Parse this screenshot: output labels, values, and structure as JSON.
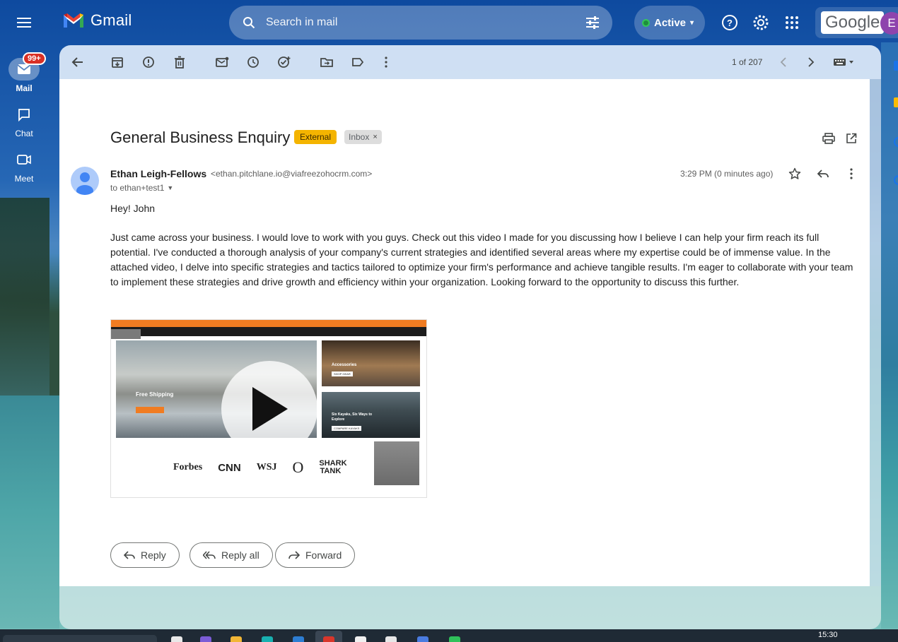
{
  "app": {
    "name": "Gmail",
    "status": "Active",
    "google_word": "Google",
    "account_initial": "E"
  },
  "search": {
    "placeholder": "Search in mail"
  },
  "rail": {
    "items": [
      {
        "label": "Mail",
        "badge": "99+",
        "icon": "mail-icon",
        "active": true
      },
      {
        "label": "Chat",
        "icon": "chat-icon",
        "active": false
      },
      {
        "label": "Meet",
        "icon": "video-icon",
        "active": false
      }
    ]
  },
  "toolbar": {
    "pager": "1 of 207"
  },
  "email": {
    "subject": "General Business Enquiry",
    "labels": {
      "external": "External",
      "inbox": "Inbox",
      "inbox_remove": "×"
    },
    "sender_name": "Ethan Leigh-Fellows",
    "sender_email": "<ethan.pitchlane.io@viafreezohocrm.com>",
    "to": "to ethan+test1",
    "timestamp": "3:29 PM (0 minutes ago)",
    "greeting": "Hey! John",
    "body": "Just came across your business. I would love to work with you guys. Check out this video I made for you discussing how I believe I can help your firm reach its full potential. I've conducted a thorough analysis of your company's current strategies and identified several areas where my expertise could be of immense value. In the attached video, I delve into specific strategies and tactics tailored to optimize your firm's performance and achieve tangible results. I'm eager to collaborate with your team to implement these strategies and drive growth and efficiency within your organization. Looking forward to the opportunity to discuss this further.",
    "video": {
      "hero_text": "Free Shipping",
      "tile1_text": "Accessories",
      "tile1_button": "SHOP GEAR",
      "tile2_text": "Six Kayaks, Six Ways to Explore",
      "tile2_button": "COMPARE KAYAKS",
      "logos": [
        "Forbes",
        "CNN",
        "WSJ",
        "O",
        "SHARK TANK"
      ]
    }
  },
  "actions": {
    "reply": "Reply",
    "reply_all": "Reply all",
    "forward": "Forward"
  },
  "taskbar": {
    "clock": "15:30"
  },
  "colors": {
    "external_label": "#f4b400",
    "badge": "#d93025",
    "status_green": "#1e8e3e"
  }
}
